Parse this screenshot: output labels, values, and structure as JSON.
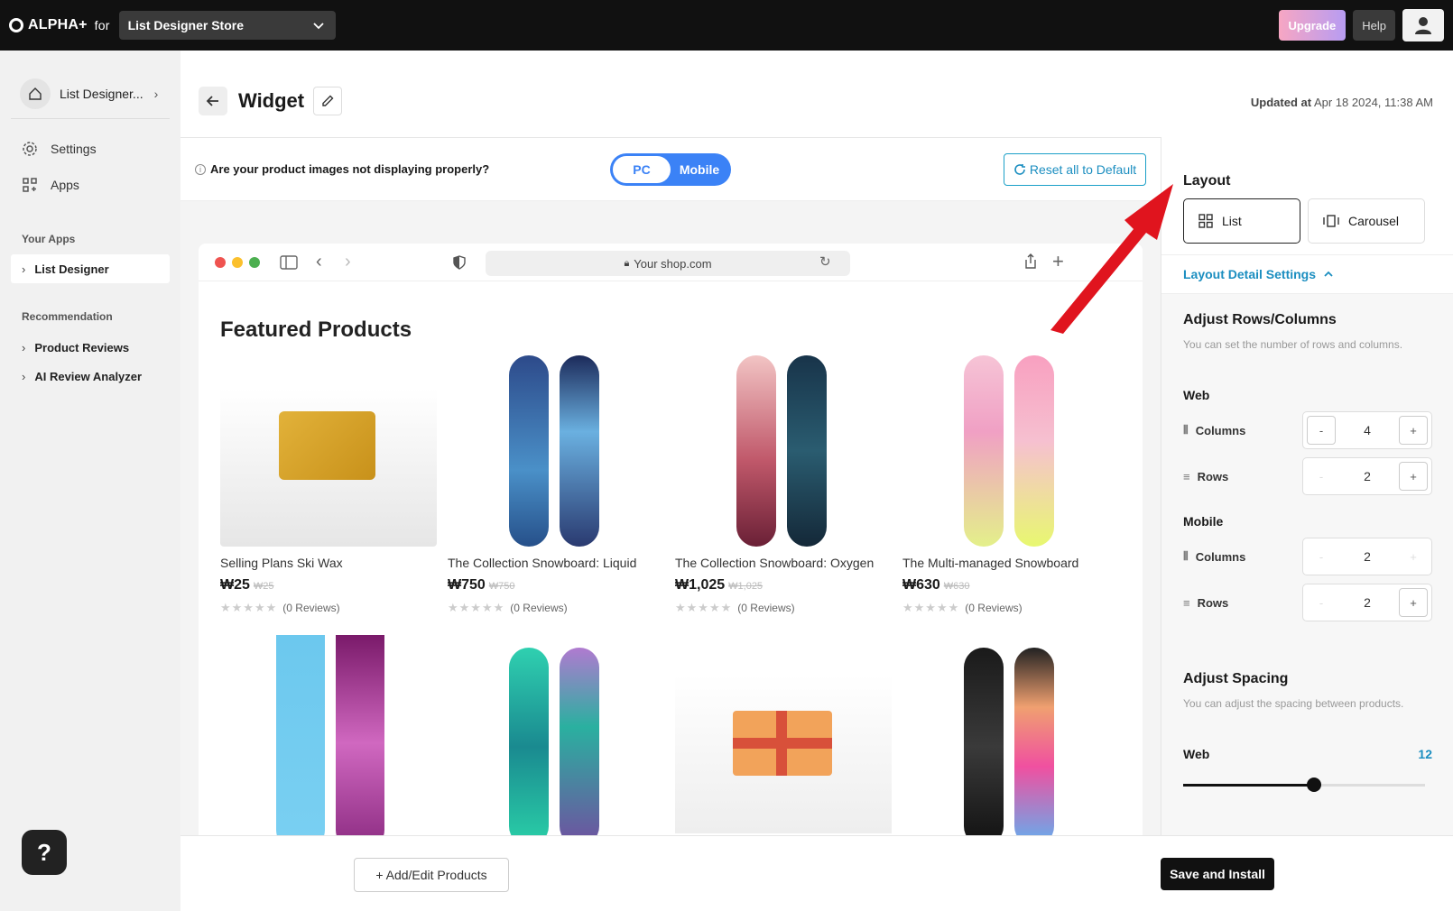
{
  "topbar": {
    "brand": "ALPHA+",
    "for_label": "for",
    "store": "List Designer Store",
    "upgrade": "Upgrade",
    "help": "Help"
  },
  "sidebar": {
    "home_label": "List Designer...",
    "nav": [
      {
        "label": "Settings",
        "icon": "gear-icon"
      },
      {
        "label": "Apps",
        "icon": "apps-icon"
      }
    ],
    "your_apps_title": "Your Apps",
    "your_apps": [
      {
        "label": "List Designer"
      }
    ],
    "recommendation_title": "Recommendation",
    "recommendations": [
      {
        "label": "Product Reviews"
      },
      {
        "label": "AI Review Analyzer"
      }
    ],
    "help_fab": "?"
  },
  "header": {
    "title": "Widget",
    "updated_label": "Updated at",
    "updated_value": "Apr 18 2024, 11:38 AM"
  },
  "toolbar": {
    "image_question": "Are your product images not displaying properly?",
    "toggle_pc": "PC",
    "toggle_mobile": "Mobile",
    "reset": "Reset all to Default"
  },
  "browser": {
    "url": "Your shop.com"
  },
  "preview": {
    "heading": "Featured Products",
    "products": [
      {
        "name": "Selling Plans Ski Wax",
        "price": "₩25",
        "compare": "₩25",
        "reviews": "(0 Reviews)"
      },
      {
        "name": "The Collection Snowboard: Liquid",
        "price": "₩750",
        "compare": "₩750",
        "reviews": "(0 Reviews)"
      },
      {
        "name": "The Collection Snowboard: Oxygen",
        "price": "₩1,025",
        "compare": "₩1,025",
        "reviews": "(0 Reviews)"
      },
      {
        "name": "The Multi-managed Snowboard",
        "price": "₩630",
        "compare": "₩630",
        "reviews": "(0 Reviews)"
      }
    ],
    "rating_stars": 0
  },
  "panel": {
    "layout_title": "Layout",
    "layout_options": [
      {
        "label": "List",
        "selected": true
      },
      {
        "label": "Carousel",
        "selected": false
      }
    ],
    "detail_settings": "Layout Detail Settings",
    "rows_cols_title": "Adjust Rows/Columns",
    "rows_cols_note": "You can set the number of rows and columns.",
    "web_label": "Web",
    "mobile_label": "Mobile",
    "columns_label": "Columns",
    "rows_label": "Rows",
    "web_columns": "4",
    "web_rows": "2",
    "mobile_columns": "2",
    "mobile_rows": "2",
    "spacing_title": "Adjust Spacing",
    "spacing_note": "You can adjust the spacing between products.",
    "spacing_web_label": "Web",
    "spacing_web_value": "12",
    "spacing_web_fraction": 0.54
  },
  "footer": {
    "add_edit": "+ Add/Edit Products",
    "save": "Save and Install"
  },
  "colors": {
    "accent": "#3b82f6",
    "link": "#1b8ec0",
    "annotation_arrow": "#e0141e"
  }
}
